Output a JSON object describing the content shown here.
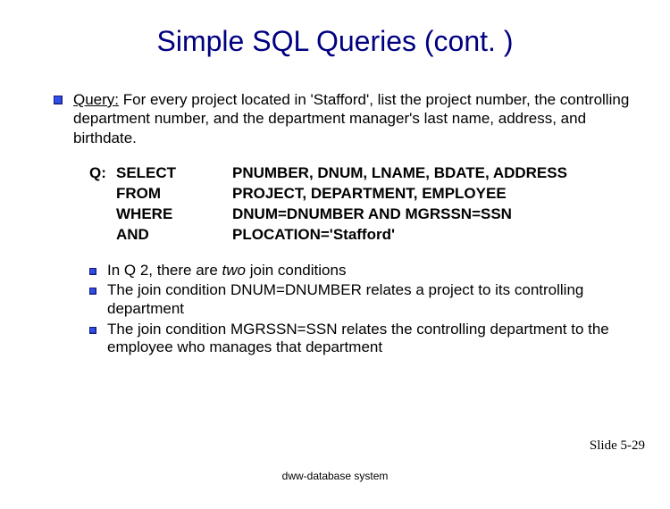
{
  "title": "Simple SQL Queries (cont. )",
  "query_label": "Query:",
  "query_text": " For every project located in 'Stafford', list the project number, the controlling department number, and the department manager's last name, address, and birthdate.",
  "sql": {
    "label": "Q:",
    "keywords": "SELECT\nFROM\nWHERE\nAND",
    "values": "PNUMBER, DNUM, LNAME, BDATE, ADDRESS\nPROJECT, DEPARTMENT, EMPLOYEE\nDNUM=DNUMBER AND MGRSSN=SSN\nPLOCATION='Stafford'"
  },
  "notes": [
    {
      "pre": "In Q 2, there are ",
      "em": "two",
      "post": "  join conditions"
    },
    {
      "pre": "The join condition DNUM=DNUMBER relates a project to its controlling department",
      "em": "",
      "post": ""
    },
    {
      "pre": "The join condition MGRSSN=SSN relates the controlling department to the employee who manages that department",
      "em": "",
      "post": ""
    }
  ],
  "slide_number": "Slide 5-29",
  "footer": "dww-database system"
}
